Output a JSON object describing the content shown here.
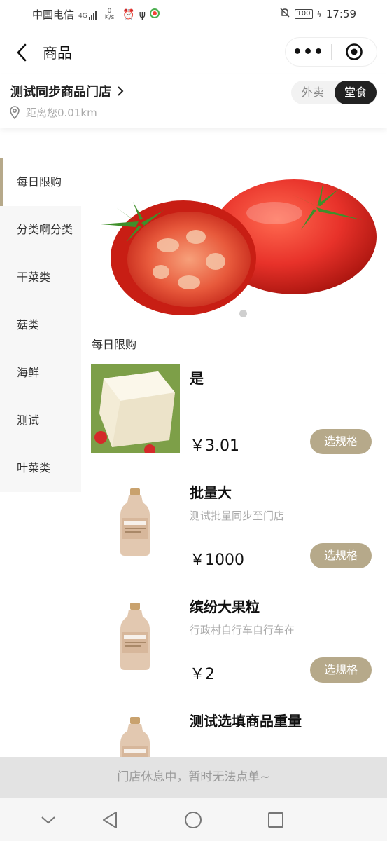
{
  "status_bar": {
    "carrier": "中国电信",
    "network": "4G",
    "speed_value": "0",
    "speed_unit": "K/s",
    "battery": "100",
    "time": "17:59"
  },
  "nav": {
    "title": "商品",
    "more_label": "•••"
  },
  "store": {
    "name": "测试同步商品门店",
    "distance": "距离您0.01km",
    "modes": [
      {
        "label": "外卖",
        "selected": false
      },
      {
        "label": "堂食",
        "selected": true
      }
    ]
  },
  "categories": [
    {
      "label": "每日限购",
      "active": true
    },
    {
      "label": "分类啊分类",
      "active": false
    },
    {
      "label": "干菜类",
      "active": false
    },
    {
      "label": "菇类",
      "active": false
    },
    {
      "label": "海鲜",
      "active": false
    },
    {
      "label": "测试",
      "active": false
    },
    {
      "label": "叶菜类",
      "active": false
    }
  ],
  "section_title": "每日限购",
  "products": [
    {
      "name": "是",
      "desc": "",
      "price": "￥3.01",
      "button": "选规格",
      "image": "tofu"
    },
    {
      "name": "批量大",
      "desc": "测试批量同步至门店",
      "price": "￥1000",
      "button": "选规格",
      "image": "bottle"
    },
    {
      "name": "缤纷大果粒",
      "desc": "行政村自行车自行车在",
      "price": "￥2",
      "button": "选规格",
      "image": "bottle"
    },
    {
      "name": "测试选填商品重量",
      "desc": "",
      "price": "",
      "button": "",
      "image": "bottle"
    }
  ],
  "closed_notice": "门店休息中，暂时无法点单~",
  "colors": {
    "accent": "#b6a98a",
    "dark": "#222222",
    "sidebar_bg": "#f7f7f7",
    "tomato_red": "#e8322a"
  }
}
